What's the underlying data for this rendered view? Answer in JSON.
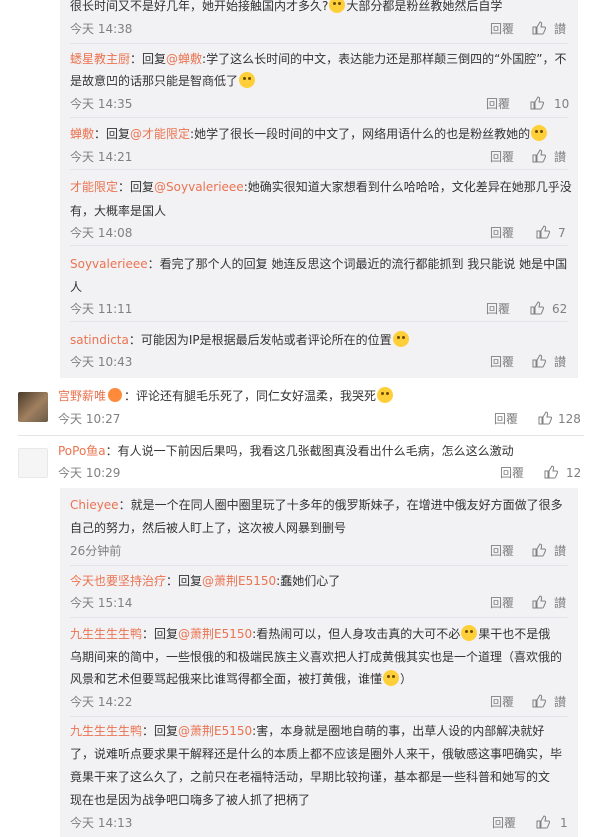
{
  "sub1": {
    "items": [
      {
        "name": "",
        "text": "很长时间又不是好几年，她开始接触国内才多久?",
        "text2": "大部分都是粉丝教她然后自学",
        "time": "今天 14:38",
        "reply": "回覆",
        "like": "讃"
      },
      {
        "name": "蟋星教主厨",
        "colon": "：回复",
        "mention": "@蝉敷",
        "text": ":学了这么长时间的中文，表达能力还是那样颠三倒四的“外国腔”，不",
        "line2": "是故意凹的话那只能是智商低了",
        "time": "今天 14:35",
        "reply": "回覆",
        "like": "10"
      },
      {
        "name": "蝉敷",
        "colon": "：回复",
        "mention": "@才能限定",
        "text": ":她学了很长一段时间的中文了，网络用语什么的也是粉丝教她的",
        "time": "今天 14:21",
        "reply": "回覆",
        "like": "讃"
      },
      {
        "name": "才能限定",
        "colon": "：回复",
        "mention": "@Soyvalerieee",
        "text": ":她确实很知道大家想看到什么哈哈哈，文化差异在她那几乎没",
        "line2": "有，大概率是国人",
        "time": "今天 14:08",
        "reply": "回覆",
        "like": "7"
      },
      {
        "name": "Soyvalerieee",
        "colon": "：",
        "text": "看完了那个人的回复 她连反思这个词最近的流行都能抓到 我只能说 她是中国",
        "line2": "人",
        "time": "今天 11:11",
        "reply": "回覆",
        "like": "62"
      },
      {
        "name": "satindicta",
        "colon": "：",
        "text": "可能因为IP是根据最后发帖或者评论所在的位置",
        "time": "今天 10:43",
        "reply": "回覆",
        "like": "讃"
      }
    ]
  },
  "top1": {
    "name": "宫野薪唯",
    "colon": "：",
    "text": "评论还有腿毛乐死了，同仁女好温柔，我哭死",
    "time": "今天 10:27",
    "reply": "回覆",
    "like": "128"
  },
  "top2": {
    "name": "PoPo鱼a",
    "colon": "：",
    "text": "有人说一下前因后果吗，我看这几张截图真没看出什么毛病，怎么这么激动",
    "time": "今天 10:29",
    "reply": "回覆",
    "like": "12"
  },
  "sub2": {
    "items": [
      {
        "name": "Chieyee",
        "colon": "：",
        "text": "就是一个在同人圈中圈里玩了十多年的俄罗斯妹子，在增进中俄友好方面做了很多",
        "line2": "自己的努力，然后被人盯上了，这次被人网暴到删号",
        "time": "26分钟前",
        "reply": "回覆",
        "like": "讃"
      },
      {
        "name": "今天也要坚持治疗",
        "colon": "：回复",
        "mention": "@萧荆E5150",
        "text": ":蠢她们心了",
        "time": "今天 15:14",
        "reply": "回覆",
        "like": "讃"
      },
      {
        "name": "九生生生生鸭",
        "colon": "：回复",
        "mention": "@萧荆E5150",
        "text": ":看热闹可以，但人身攻击真的大可不必",
        "text_b": "果干也不是俄",
        "line2": "乌期间来的简中，一些恨俄的和极端民族主义喜欢把人打成黄俄其实也是一个道理（喜欢俄的",
        "line3": "风景和艺术但要骂起俄来比谁骂得都全面，被打黄俄，谁懂",
        "line3b": "）",
        "time": "今天 14:22",
        "reply": "回覆",
        "like": "讃"
      },
      {
        "name": "九生生生生鸭",
        "colon": "：回复",
        "mention": "@萧荆E5150",
        "text": ":害，本身就是圈地自萌的事，出草人设的内部解决就好",
        "line2": "了，说难听点要求果干解释还是什么的本质上都不应该是圈外人来干，俄敏感这事吧确实，毕",
        "line3": "竟果干来了这么久了，之前只在老福特活动，早期比较拘谨，基本都是一些科普和她写的文",
        "line4": "现在也是因为战争吧口嗨多了被人抓了把柄了",
        "time": "今天 14:13",
        "reply": "回覆",
        "like": "1"
      }
    ]
  },
  "colors": {
    "accent": "#eb7350",
    "meta": "#808080",
    "subbg": "#f2f2f5",
    "text": "#333333"
  },
  "icons": {
    "like": "thumbs-up-icon",
    "emoji": "emoji-icon",
    "badge": "badge-icon"
  }
}
